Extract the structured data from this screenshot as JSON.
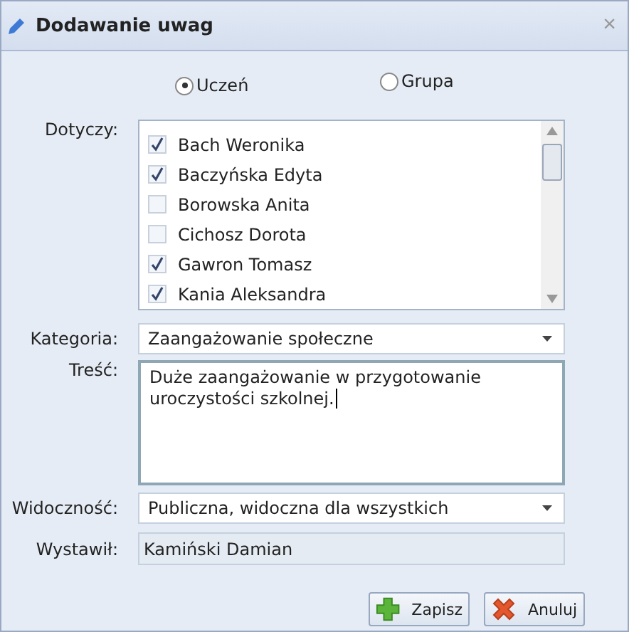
{
  "window": {
    "title": "Dodawanie uwag",
    "close": "×"
  },
  "target_options": [
    {
      "label": "Uczeń",
      "selected": true
    },
    {
      "label": "Grupa",
      "selected": false
    }
  ],
  "students": {
    "label": "Dotyczy:",
    "items": [
      {
        "name": "Bach Weronika",
        "checked": true
      },
      {
        "name": "Baczyńska Edyta",
        "checked": true
      },
      {
        "name": "Borowska Anita",
        "checked": false
      },
      {
        "name": "Cichosz Dorota",
        "checked": false
      },
      {
        "name": "Gawron Tomasz",
        "checked": true
      },
      {
        "name": "Kania Aleksandra",
        "checked": true
      }
    ]
  },
  "category": {
    "label": "Kategoria:",
    "value": "Zaangażowanie społeczne"
  },
  "content": {
    "label": "Treść:",
    "value": "Duże zaangażowanie w przygotowanie uroczystości szkolnej."
  },
  "visibility": {
    "label": "Widoczność:",
    "value": "Publiczna, widoczna dla wszystkich"
  },
  "author": {
    "label": "Wystawił:",
    "value": "Kamiński Damian"
  },
  "buttons": [
    {
      "kind": "save",
      "label": "Zapisz"
    },
    {
      "kind": "cancel",
      "label": "Anuluj"
    }
  ]
}
